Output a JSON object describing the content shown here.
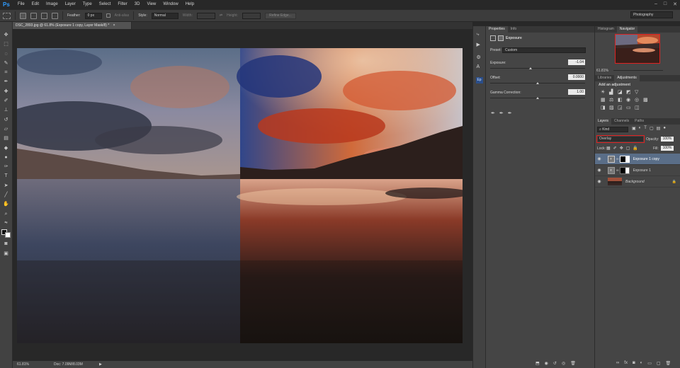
{
  "app": {
    "logo": "Ps",
    "window_controls": [
      "‒",
      "□",
      "✕"
    ]
  },
  "menu": [
    "File",
    "Edit",
    "Image",
    "Layer",
    "Type",
    "Select",
    "Filter",
    "3D",
    "View",
    "Window",
    "Help"
  ],
  "options_bar": {
    "feather_label": "Feather:",
    "feather_value": "0 px",
    "anti_alias": "Anti-alias",
    "style_label": "Style:",
    "style_value": "Normal",
    "width_label": "Width:",
    "height_label": "Height:",
    "refine_edge": "Refine Edge...",
    "workspace": "Photography"
  },
  "document": {
    "tab_title": "DSC_2893.jpg @ 61.8% (Exposure 1 copy, Layer Mask/8) *",
    "tab_close": "×",
    "zoom": "61.81%",
    "doc_info": "Doc: 7.09M/8.03M"
  },
  "properties": {
    "tabs": [
      "Properties",
      "Info"
    ],
    "title": "Exposure",
    "preset_label": "Preset:",
    "preset_value": "Custom",
    "exposure_label": "Exposure:",
    "exposure_value": "-1.04",
    "offset_label": "Offset:",
    "offset_value": "0.0000",
    "gamma_label": "Gamma Correction:",
    "gamma_value": "1.00"
  },
  "navigator": {
    "tabs": [
      "Histogram",
      "Navigator"
    ],
    "zoom": "61.81%"
  },
  "adjustments": {
    "tabs": [
      "Libraries",
      "Adjustments"
    ],
    "title": "Add an adjustment"
  },
  "layers": {
    "tabs": [
      "Layers",
      "Channels",
      "Paths"
    ],
    "kind_label": "Kind",
    "blend_mode": "Overlay",
    "opacity_label": "Opacity:",
    "opacity_value": "100%",
    "lock_label": "Lock:",
    "fill_label": "Fill:",
    "fill_value": "100%",
    "items": [
      {
        "name": "Exposure 1 copy",
        "selected": true
      },
      {
        "name": "Exposure 1",
        "selected": false
      },
      {
        "name": "Background",
        "selected": false
      }
    ],
    "footer_icons": [
      "link-icon",
      "fx-icon",
      "mask-icon",
      "adjustment-icon",
      "folder-icon",
      "new-layer-icon",
      "trash-icon"
    ]
  },
  "colors": {
    "accent": "#2f9bff",
    "highlight_red": "#e02020",
    "selected_row": "#5a6e88"
  }
}
